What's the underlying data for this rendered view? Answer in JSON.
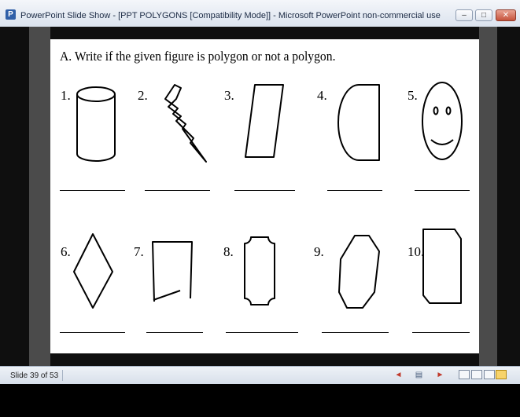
{
  "window": {
    "app_icon_letter": "P",
    "title": "PowerPoint Slide Show - [PPT POLYGONS [Compatibility Mode]] - Microsoft PowerPoint non-commercial use",
    "buttons": {
      "minimize": "–",
      "maximize": "□",
      "close": "✕"
    }
  },
  "slide": {
    "heading": "A. Write if the given figure is polygon or not a polygon.",
    "items": [
      {
        "label": "1.",
        "shape": "cylinder"
      },
      {
        "label": "2.",
        "shape": "lightning-bolt"
      },
      {
        "label": "3.",
        "shape": "parallelogram"
      },
      {
        "label": "4.",
        "shape": "rounded-quadrant"
      },
      {
        "label": "5.",
        "shape": "smiley-face"
      },
      {
        "label": "6.",
        "shape": "rhombus"
      },
      {
        "label": "7.",
        "shape": "open-quadrilateral"
      },
      {
        "label": "8.",
        "shape": "notched-rectangle"
      },
      {
        "label": "9.",
        "shape": "heptagon"
      },
      {
        "label": "10.",
        "shape": "cut-corner-rectangle"
      }
    ]
  },
  "statusbar": {
    "slide_count": "Slide 39 of 53",
    "icons": [
      "previous-arrow-icon",
      "menu-icon",
      "next-arrow-icon",
      "normal-view-icon",
      "slide-sorter-icon",
      "reading-view-icon",
      "slide-show-icon"
    ]
  }
}
